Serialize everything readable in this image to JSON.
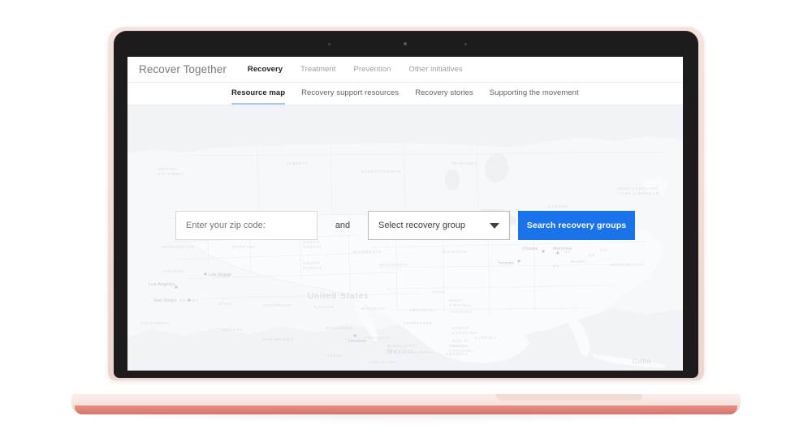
{
  "device": {
    "type": "laptop",
    "body_color": "#f3ded8",
    "base_front_color": "#d9756a",
    "bezel_color": "#1d1b1b"
  },
  "site": {
    "logo": "Recover Together",
    "top_nav": [
      {
        "label": "Recovery",
        "active": true
      },
      {
        "label": "Treatment",
        "active": false
      },
      {
        "label": "Prevention",
        "active": false
      },
      {
        "label": "Other initiatives",
        "active": false
      }
    ],
    "sub_nav": [
      {
        "label": "Resource map",
        "active": true
      },
      {
        "label": "Recovery support resources",
        "active": false
      },
      {
        "label": "Recovery stories",
        "active": false
      },
      {
        "label": "Supporting the movement",
        "active": false
      }
    ],
    "accent_color": "#1a73e8",
    "active_underline_color": "#a8c7f7"
  },
  "search_form": {
    "zip_placeholder": "Enter your zip code:",
    "zip_value": "",
    "conjunction": "and",
    "select_label": "Select recovery group",
    "select_value": "",
    "submit_label": "Search recovery groups"
  },
  "map": {
    "background_color": "#f1f3f6",
    "land_color": "#f7f8fa",
    "country_labels": [
      "United States",
      "Mexico",
      "Cuba"
    ],
    "state_labels": [
      "WASHINGTON",
      "OREGON",
      "IDAHO",
      "MONTANA",
      "NORTH DAKOTA",
      "SOUTH DAKOTA",
      "MINNESOTA",
      "WISCONSIN",
      "MICHIGAN",
      "NEVADA",
      "UTAH",
      "COLORADO",
      "KANSAS",
      "MISSOURI",
      "CALIFORNIA",
      "ARIZONA",
      "NEW MEXICO",
      "OKLAHOMA",
      "ARKANSAS",
      "TEXAS",
      "LOUISIANA",
      "MISSISSIPPI",
      "ALABAMA",
      "GEORGIA",
      "FLORIDA",
      "TENNESSEE",
      "KENTUCKY",
      "VIRGINIA",
      "WEST VIRGINIA",
      "NORTH CAROLINA",
      "SOUTH CAROLINA",
      "OHIO",
      "MAINE",
      "VT",
      "NH"
    ],
    "province_labels": [
      "BRITISH COLUMBIA",
      "ALBERTA",
      "SASKATCHEWAN",
      "MANITOBA",
      "ONTARIO",
      "QUEBEC",
      "NEWFOUNDLAND AND LABRADOR",
      "NOVA SCOTIA",
      "NB",
      "PEI"
    ],
    "city_labels": [
      "Las Vegas",
      "Los Angeles",
      "San Diego",
      "Houston",
      "Ottawa",
      "Montreal",
      "Toronto"
    ]
  }
}
